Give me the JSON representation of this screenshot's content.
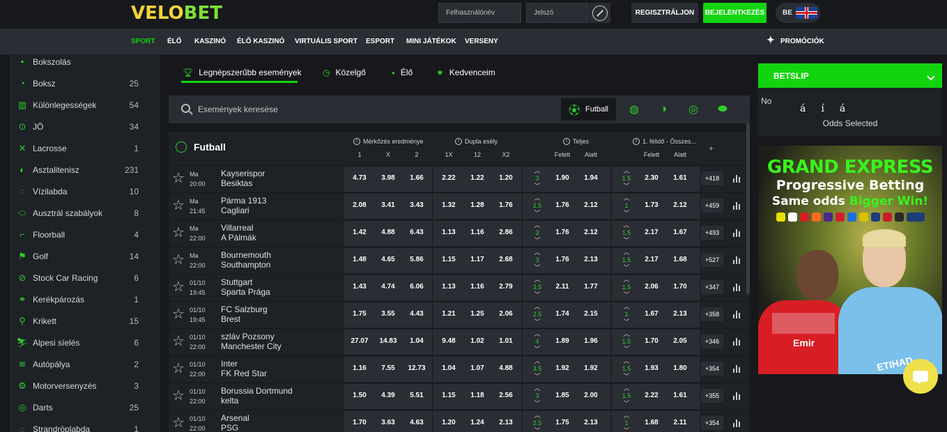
{
  "header": {
    "logo_left": "VELO",
    "logo_right": "BET",
    "username_placeholder": "Felhasználónév",
    "password_placeholder": "Jelszó",
    "register_label": "REGISZTRÁLJON",
    "login_label": "BEJELENTKEZÉS",
    "language": "BE"
  },
  "nav": {
    "items": [
      "SPORT",
      "ÉLŐ",
      "KASZINÓ",
      "ÉLŐ KASZINÓ",
      "VIRTUÁLIS SPORT",
      "ESPORT",
      "MINI JÁTÉKOK",
      "VERSENY"
    ],
    "promo_label": "PROMÓCIÓK"
  },
  "sidebar": {
    "items": [
      {
        "label": "Bokszolás",
        "count": "",
        "icon": "•"
      },
      {
        "label": "Boksz",
        "count": "25",
        "icon": "◔"
      },
      {
        "label": "Különlegességek",
        "count": "54",
        "icon": "▥"
      },
      {
        "label": "JÖ",
        "count": "34",
        "icon": "⊙"
      },
      {
        "label": "Lacrosse",
        "count": "1",
        "icon": "✕"
      },
      {
        "label": "Asztalitenisz",
        "count": "231",
        "icon": "◐"
      },
      {
        "label": "Vízilabda",
        "count": "10",
        "icon": "◌"
      },
      {
        "label": "Ausztrál szabályok",
        "count": "8",
        "icon": "⬭"
      },
      {
        "label": "Floorball",
        "count": "4",
        "icon": "⌐"
      },
      {
        "label": "Golf",
        "count": "14",
        "icon": "⚑"
      },
      {
        "label": "Stock Car Racing",
        "count": "6",
        "icon": "⊘"
      },
      {
        "label": "Kerékpározás",
        "count": "1",
        "icon": "⚭"
      },
      {
        "label": "Krikett",
        "count": "15",
        "icon": "⚲"
      },
      {
        "label": "Alpesi síelés",
        "count": "6",
        "icon": "⛷"
      },
      {
        "label": "Autópálya",
        "count": "2",
        "icon": "≋"
      },
      {
        "label": "Motorversenyzés",
        "count": "3",
        "icon": "⚙"
      },
      {
        "label": "Darts",
        "count": "25",
        "icon": "◎"
      },
      {
        "label": "Strandröplabda",
        "count": "1",
        "icon": "◌"
      }
    ]
  },
  "tabs": {
    "items": [
      "Legnépszerűbb események",
      "Közelgő",
      "Élő",
      "Kedvenceim"
    ]
  },
  "search": {
    "placeholder": "Események keresése",
    "active_sport": "Futball"
  },
  "table": {
    "sport": "Futball",
    "groups": [
      "Mérkőzés eredménye",
      "Dupla esély",
      "Teljes",
      "1. félidő - Összes..."
    ],
    "subheaders": {
      "result": [
        "1",
        "X",
        "2"
      ],
      "double": [
        "1X",
        "12",
        "X2"
      ],
      "total": [
        "Felett",
        "Alatt"
      ],
      "half": [
        "Felett",
        "Alatt"
      ]
    },
    "plus": "+",
    "rows": [
      {
        "day": "Ma",
        "time": "20:00",
        "home": "Kayserispor",
        "away": "Besiktas",
        "r1": "4.73",
        "rx": "3.98",
        "r2": "1.66",
        "d1": "2.22",
        "d2": "1.22",
        "d3": "1.20",
        "tl": "3",
        "to": "1.90",
        "tu": "1.94",
        "hl": "1.5",
        "ho": "2.30",
        "hu": "1.61",
        "more": "+418"
      },
      {
        "day": "Ma",
        "time": "21:45",
        "home": "Pármа 1913",
        "away": "Cagliari",
        "r1": "2.08",
        "rx": "3.41",
        "r2": "3.43",
        "d1": "1.32",
        "d2": "1.28",
        "d3": "1.76",
        "tl": "2.5",
        "to": "1.76",
        "tu": "2.12",
        "hl": "1",
        "ho": "1.73",
        "hu": "2.12",
        "more": "+459"
      },
      {
        "day": "Ma",
        "time": "22:00",
        "home": "Villarreal",
        "away": "A Pálmák",
        "r1": "1.42",
        "rx": "4.88",
        "r2": "6.43",
        "d1": "1.13",
        "d2": "1.16",
        "d3": "2.86",
        "tl": "3",
        "to": "1.76",
        "tu": "2.12",
        "hl": "1.5",
        "ho": "2.17",
        "hu": "1.67",
        "more": "+493"
      },
      {
        "day": "Ma",
        "time": "22:00",
        "home": "Bournemouth",
        "away": "Southampton",
        "r1": "1.48",
        "rx": "4.65",
        "r2": "5.86",
        "d1": "1.15",
        "d2": "1.17",
        "d3": "2.68",
        "tl": "3",
        "to": "1.76",
        "tu": "2.13",
        "hl": "1.5",
        "ho": "2.17",
        "hu": "1.68",
        "more": "+527"
      },
      {
        "day": "01/10",
        "time": "19:45",
        "home": "Stuttgart",
        "away": "Sparta Prága",
        "r1": "1.43",
        "rx": "4.74",
        "r2": "6.06",
        "d1": "1.13",
        "d2": "1.16",
        "d3": "2.79",
        "tl": "3.5",
        "to": "2.11",
        "tu": "1.77",
        "hl": "1.5",
        "ho": "2.06",
        "hu": "1.70",
        "more": "+347"
      },
      {
        "day": "01/10",
        "time": "19:45",
        "home": "FC Salzburg",
        "away": "Brest",
        "r1": "1.75",
        "rx": "3.55",
        "r2": "4.43",
        "d1": "1.21",
        "d2": "1.25",
        "d3": "2.06",
        "tl": "2.5",
        "to": "1.74",
        "tu": "2.15",
        "hl": "1",
        "ho": "1.67",
        "hu": "2.13",
        "more": "+358"
      },
      {
        "day": "01/10",
        "time": "22:00",
        "home": "szláv Pozsony",
        "away": "Manchester City",
        "r1": "27.07",
        "rx": "14.83",
        "r2": "1.04",
        "d1": "9.48",
        "d2": "1.02",
        "d3": "1.01",
        "tl": "4",
        "to": "1.89",
        "tu": "1.96",
        "hl": "1.5",
        "ho": "1.70",
        "hu": "2.05",
        "more": "+346"
      },
      {
        "day": "01/10",
        "time": "22:00",
        "home": "Inter",
        "away": "FK Red Star",
        "r1": "1.16",
        "rx": "7.55",
        "r2": "12.73",
        "d1": "1.04",
        "d2": "1.07",
        "d3": "4.88",
        "tl": "3.5",
        "to": "1.92",
        "tu": "1.92",
        "hl": "1.5",
        "ho": "1.93",
        "hu": "1.80",
        "more": "+354"
      },
      {
        "day": "01/10",
        "time": "22:00",
        "home": "Borussia Dortmund",
        "away": "kelta",
        "r1": "1.50",
        "rx": "4.39",
        "r2": "5.51",
        "d1": "1.15",
        "d2": "1.18",
        "d3": "2.56",
        "tl": "3",
        "to": "1.85",
        "tu": "2.00",
        "hl": "1.5",
        "ho": "2.22",
        "hu": "1.61",
        "more": "+355"
      },
      {
        "day": "01/10",
        "time": "22:00",
        "home": "Arsenal",
        "away": "PSG",
        "r1": "1.70",
        "rx": "3.63",
        "r2": "4.63",
        "d1": "1.20",
        "d2": "1.24",
        "d3": "2.13",
        "tl": "2.5",
        "to": "1.75",
        "tu": "2.13",
        "hl": "1",
        "ho": "1.68",
        "hu": "2.11",
        "more": "+354"
      }
    ]
  },
  "betslip": {
    "title": "BETSLIP",
    "no": "No",
    "chars": [
      "á",
      "í",
      "á"
    ],
    "odds_selected": "Odds Selected"
  },
  "banner": {
    "title": "GRAND EXPRESS",
    "subtitle": "Progressive Betting",
    "line3_a": "Same odds ",
    "line3_b": "Bigger Win!",
    "shirt_text": "Emir",
    "shirt_text2": "ETIHAD"
  },
  "colors": {
    "accent": "#12d40e",
    "bg": "#16181c",
    "panel": "#1e2126",
    "cell": "#2a2d33"
  }
}
